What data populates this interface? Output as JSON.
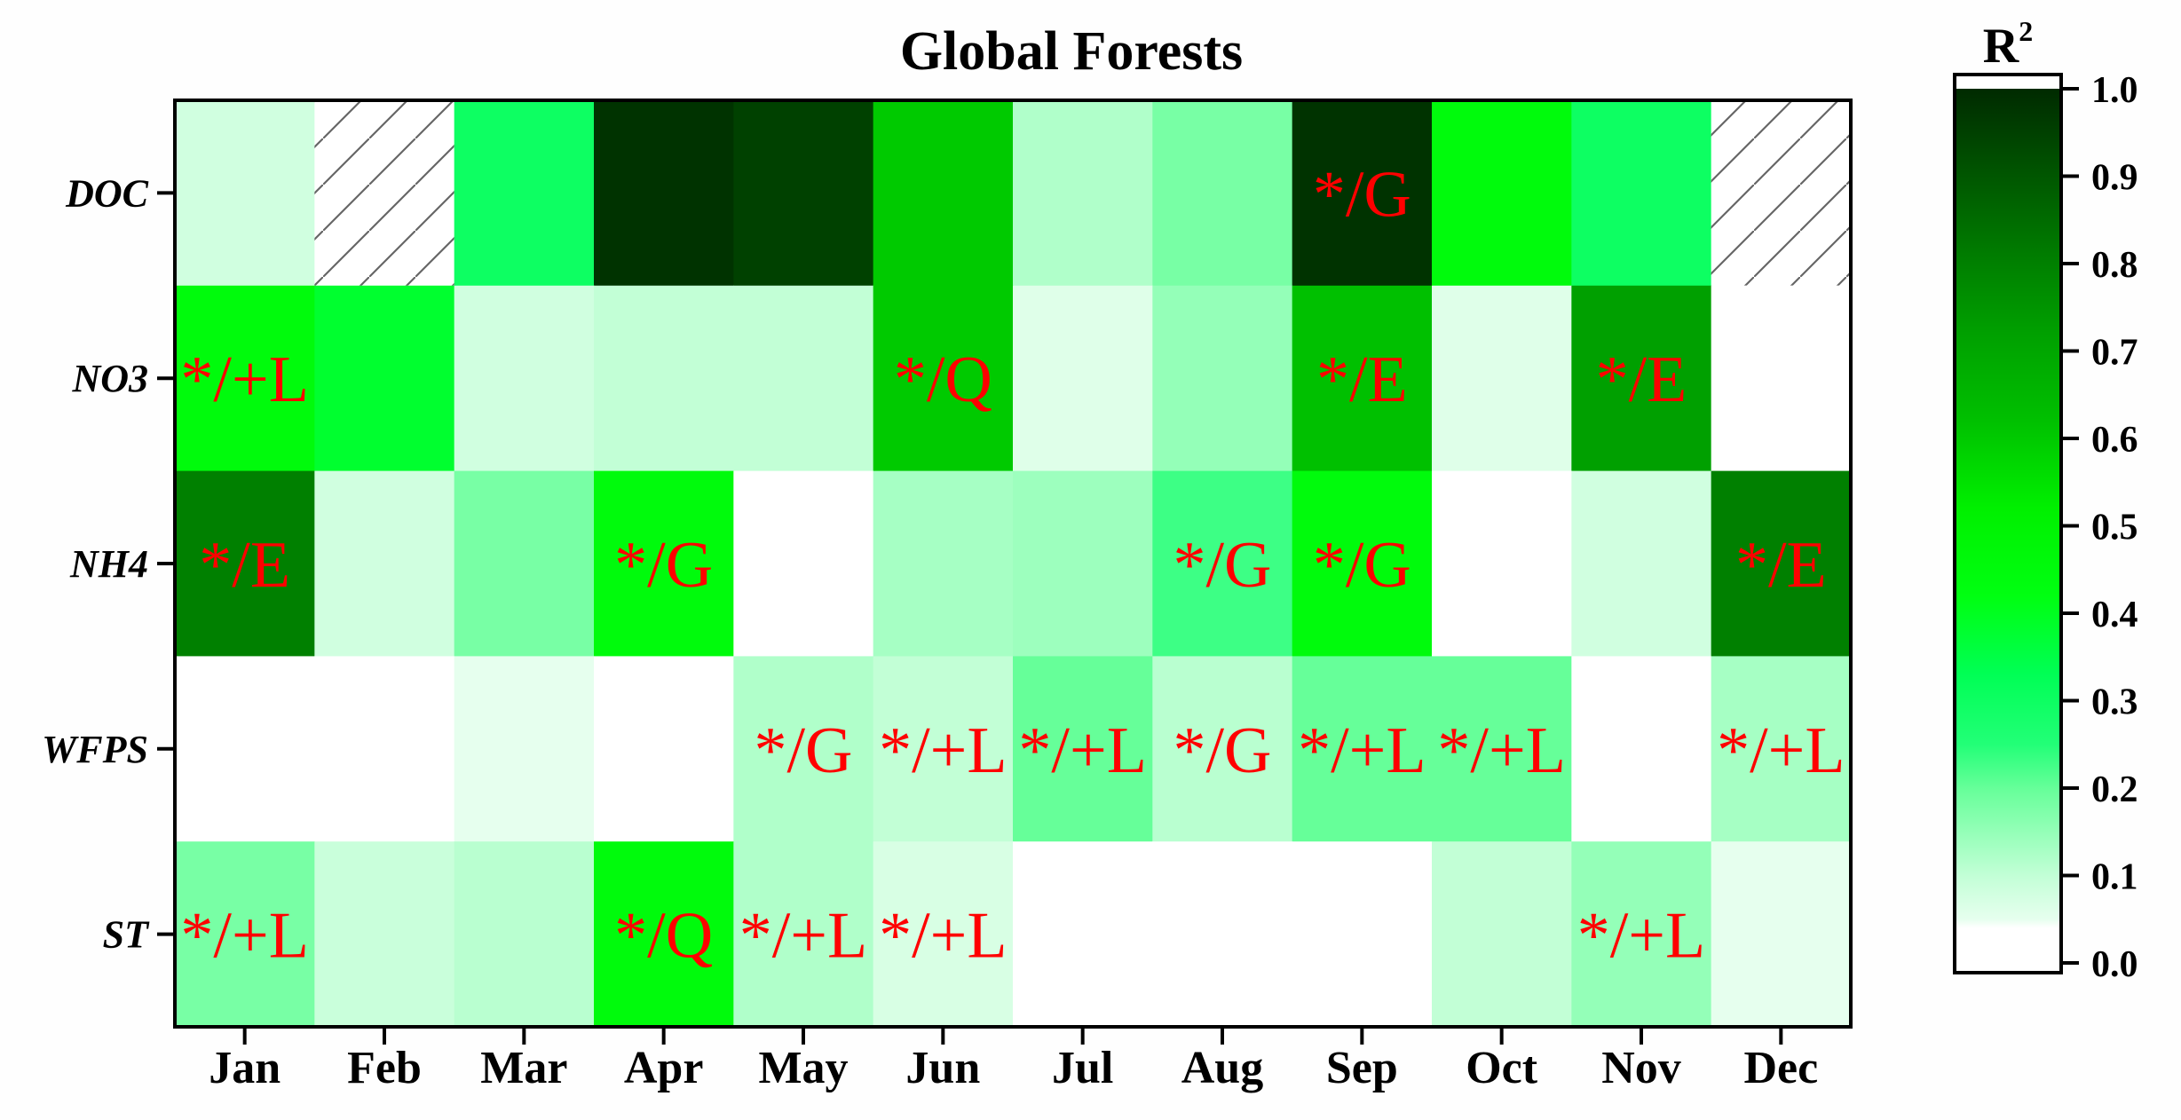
{
  "chart_data": {
    "type": "heatmap",
    "title": "Global Forests",
    "xlabel": "",
    "ylabel": "",
    "x_categories": [
      "Jan",
      "Feb",
      "Mar",
      "Apr",
      "May",
      "Jun",
      "Jul",
      "Aug",
      "Sep",
      "Oct",
      "Nov",
      "Dec"
    ],
    "y_categories": [
      "DOC",
      "NO3",
      "NH4",
      "WFPS",
      "ST"
    ],
    "values": [
      [
        0.08,
        null,
        0.3,
        0.98,
        0.95,
        0.6,
        0.12,
        0.18,
        0.98,
        0.45,
        0.3,
        null
      ],
      [
        0.45,
        0.38,
        0.08,
        0.1,
        0.1,
        0.6,
        0.06,
        0.15,
        0.62,
        0.06,
        0.72,
        0.0
      ],
      [
        0.8,
        0.08,
        0.18,
        0.45,
        0.04,
        0.13,
        0.14,
        0.23,
        0.45,
        0.0,
        0.08,
        0.8
      ],
      [
        0.0,
        0.0,
        0.05,
        0.0,
        0.12,
        0.1,
        0.2,
        0.11,
        0.2,
        0.2,
        0.0,
        0.13
      ],
      [
        0.18,
        0.09,
        0.11,
        0.45,
        0.12,
        0.07,
        0.0,
        0.0,
        0.0,
        0.1,
        0.15,
        0.05
      ]
    ],
    "annotations": [
      [
        "",
        "",
        "",
        "",
        "",
        "",
        "",
        "",
        "*/G",
        "",
        "",
        ""
      ],
      [
        "*/+L",
        "",
        "",
        "",
        "",
        "*/Q",
        "",
        "",
        "*/E",
        "",
        "*/E",
        ""
      ],
      [
        "*/E",
        "",
        "",
        "*/G",
        "",
        "",
        "",
        "*/G",
        "*/G",
        "",
        "",
        "*/E"
      ],
      [
        "",
        "",
        "",
        "",
        "*/G",
        "*/+L",
        "*/+L",
        "*/G",
        "*/+L",
        "*/+L",
        "",
        "*/+L"
      ],
      [
        "*/+L",
        "",
        "",
        "*/Q",
        "*/+L",
        "*/+L",
        "",
        "",
        "",
        "",
        "*/+L",
        ""
      ]
    ],
    "missing_cells_hatched": [
      [
        "DOC",
        "Feb"
      ],
      [
        "DOC",
        "Dec"
      ]
    ],
    "colorbar": {
      "title": "R",
      "title_superscript": "2",
      "range": [
        0.0,
        1.0
      ],
      "ticks": [
        "0.0",
        "0.1",
        "0.2",
        "0.3",
        "0.4",
        "0.5",
        "0.6",
        "0.7",
        "0.8",
        "0.9",
        "1.0"
      ],
      "stops": [
        {
          "v": 0.0,
          "c": "#ffffff"
        },
        {
          "v": 0.04,
          "c": "#ffffff"
        },
        {
          "v": 0.05,
          "c": "#e6ffee"
        },
        {
          "v": 0.1,
          "c": "#c2ffd6"
        },
        {
          "v": 0.2,
          "c": "#66ff99"
        },
        {
          "v": 0.25,
          "c": "#22ff77"
        },
        {
          "v": 0.33,
          "c": "#00ff55"
        },
        {
          "v": 0.42,
          "c": "#00ff11"
        },
        {
          "v": 0.52,
          "c": "#00f000"
        },
        {
          "v": 0.62,
          "c": "#00c000"
        },
        {
          "v": 0.72,
          "c": "#00a000"
        },
        {
          "v": 0.82,
          "c": "#007800"
        },
        {
          "v": 0.92,
          "c": "#004e00"
        },
        {
          "v": 1.0,
          "c": "#002a00"
        }
      ]
    }
  }
}
